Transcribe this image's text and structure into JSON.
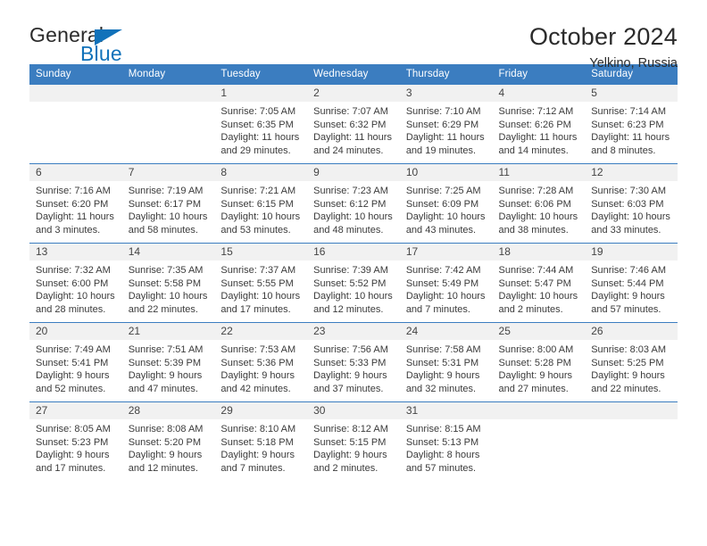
{
  "brand": {
    "name_part1": "General",
    "name_part2": "Blue",
    "accent_color": "#1172ba"
  },
  "header": {
    "month_title": "October 2024",
    "location": "Yelkino, Russia"
  },
  "calendar": {
    "header_color": "#3b7dc0",
    "weekday_headers": [
      "Sunday",
      "Monday",
      "Tuesday",
      "Wednesday",
      "Thursday",
      "Friday",
      "Saturday"
    ],
    "weeks": [
      [
        {
          "day": "",
          "empty": true
        },
        {
          "day": "",
          "empty": true
        },
        {
          "day": "1",
          "sunrise": "Sunrise: 7:05 AM",
          "sunset": "Sunset: 6:35 PM",
          "daylight": "Daylight: 11 hours and 29 minutes."
        },
        {
          "day": "2",
          "sunrise": "Sunrise: 7:07 AM",
          "sunset": "Sunset: 6:32 PM",
          "daylight": "Daylight: 11 hours and 24 minutes."
        },
        {
          "day": "3",
          "sunrise": "Sunrise: 7:10 AM",
          "sunset": "Sunset: 6:29 PM",
          "daylight": "Daylight: 11 hours and 19 minutes."
        },
        {
          "day": "4",
          "sunrise": "Sunrise: 7:12 AM",
          "sunset": "Sunset: 6:26 PM",
          "daylight": "Daylight: 11 hours and 14 minutes."
        },
        {
          "day": "5",
          "sunrise": "Sunrise: 7:14 AM",
          "sunset": "Sunset: 6:23 PM",
          "daylight": "Daylight: 11 hours and 8 minutes."
        }
      ],
      [
        {
          "day": "6",
          "sunrise": "Sunrise: 7:16 AM",
          "sunset": "Sunset: 6:20 PM",
          "daylight": "Daylight: 11 hours and 3 minutes."
        },
        {
          "day": "7",
          "sunrise": "Sunrise: 7:19 AM",
          "sunset": "Sunset: 6:17 PM",
          "daylight": "Daylight: 10 hours and 58 minutes."
        },
        {
          "day": "8",
          "sunrise": "Sunrise: 7:21 AM",
          "sunset": "Sunset: 6:15 PM",
          "daylight": "Daylight: 10 hours and 53 minutes."
        },
        {
          "day": "9",
          "sunrise": "Sunrise: 7:23 AM",
          "sunset": "Sunset: 6:12 PM",
          "daylight": "Daylight: 10 hours and 48 minutes."
        },
        {
          "day": "10",
          "sunrise": "Sunrise: 7:25 AM",
          "sunset": "Sunset: 6:09 PM",
          "daylight": "Daylight: 10 hours and 43 minutes."
        },
        {
          "day": "11",
          "sunrise": "Sunrise: 7:28 AM",
          "sunset": "Sunset: 6:06 PM",
          "daylight": "Daylight: 10 hours and 38 minutes."
        },
        {
          "day": "12",
          "sunrise": "Sunrise: 7:30 AM",
          "sunset": "Sunset: 6:03 PM",
          "daylight": "Daylight: 10 hours and 33 minutes."
        }
      ],
      [
        {
          "day": "13",
          "sunrise": "Sunrise: 7:32 AM",
          "sunset": "Sunset: 6:00 PM",
          "daylight": "Daylight: 10 hours and 28 minutes."
        },
        {
          "day": "14",
          "sunrise": "Sunrise: 7:35 AM",
          "sunset": "Sunset: 5:58 PM",
          "daylight": "Daylight: 10 hours and 22 minutes."
        },
        {
          "day": "15",
          "sunrise": "Sunrise: 7:37 AM",
          "sunset": "Sunset: 5:55 PM",
          "daylight": "Daylight: 10 hours and 17 minutes."
        },
        {
          "day": "16",
          "sunrise": "Sunrise: 7:39 AM",
          "sunset": "Sunset: 5:52 PM",
          "daylight": "Daylight: 10 hours and 12 minutes."
        },
        {
          "day": "17",
          "sunrise": "Sunrise: 7:42 AM",
          "sunset": "Sunset: 5:49 PM",
          "daylight": "Daylight: 10 hours and 7 minutes."
        },
        {
          "day": "18",
          "sunrise": "Sunrise: 7:44 AM",
          "sunset": "Sunset: 5:47 PM",
          "daylight": "Daylight: 10 hours and 2 minutes."
        },
        {
          "day": "19",
          "sunrise": "Sunrise: 7:46 AM",
          "sunset": "Sunset: 5:44 PM",
          "daylight": "Daylight: 9 hours and 57 minutes."
        }
      ],
      [
        {
          "day": "20",
          "sunrise": "Sunrise: 7:49 AM",
          "sunset": "Sunset: 5:41 PM",
          "daylight": "Daylight: 9 hours and 52 minutes."
        },
        {
          "day": "21",
          "sunrise": "Sunrise: 7:51 AM",
          "sunset": "Sunset: 5:39 PM",
          "daylight": "Daylight: 9 hours and 47 minutes."
        },
        {
          "day": "22",
          "sunrise": "Sunrise: 7:53 AM",
          "sunset": "Sunset: 5:36 PM",
          "daylight": "Daylight: 9 hours and 42 minutes."
        },
        {
          "day": "23",
          "sunrise": "Sunrise: 7:56 AM",
          "sunset": "Sunset: 5:33 PM",
          "daylight": "Daylight: 9 hours and 37 minutes."
        },
        {
          "day": "24",
          "sunrise": "Sunrise: 7:58 AM",
          "sunset": "Sunset: 5:31 PM",
          "daylight": "Daylight: 9 hours and 32 minutes."
        },
        {
          "day": "25",
          "sunrise": "Sunrise: 8:00 AM",
          "sunset": "Sunset: 5:28 PM",
          "daylight": "Daylight: 9 hours and 27 minutes."
        },
        {
          "day": "26",
          "sunrise": "Sunrise: 8:03 AM",
          "sunset": "Sunset: 5:25 PM",
          "daylight": "Daylight: 9 hours and 22 minutes."
        }
      ],
      [
        {
          "day": "27",
          "sunrise": "Sunrise: 8:05 AM",
          "sunset": "Sunset: 5:23 PM",
          "daylight": "Daylight: 9 hours and 17 minutes."
        },
        {
          "day": "28",
          "sunrise": "Sunrise: 8:08 AM",
          "sunset": "Sunset: 5:20 PM",
          "daylight": "Daylight: 9 hours and 12 minutes."
        },
        {
          "day": "29",
          "sunrise": "Sunrise: 8:10 AM",
          "sunset": "Sunset: 5:18 PM",
          "daylight": "Daylight: 9 hours and 7 minutes."
        },
        {
          "day": "30",
          "sunrise": "Sunrise: 8:12 AM",
          "sunset": "Sunset: 5:15 PM",
          "daylight": "Daylight: 9 hours and 2 minutes."
        },
        {
          "day": "31",
          "sunrise": "Sunrise: 8:15 AM",
          "sunset": "Sunset: 5:13 PM",
          "daylight": "Daylight: 8 hours and 57 minutes."
        },
        {
          "day": "",
          "empty": true
        },
        {
          "day": "",
          "empty": true
        }
      ]
    ]
  }
}
